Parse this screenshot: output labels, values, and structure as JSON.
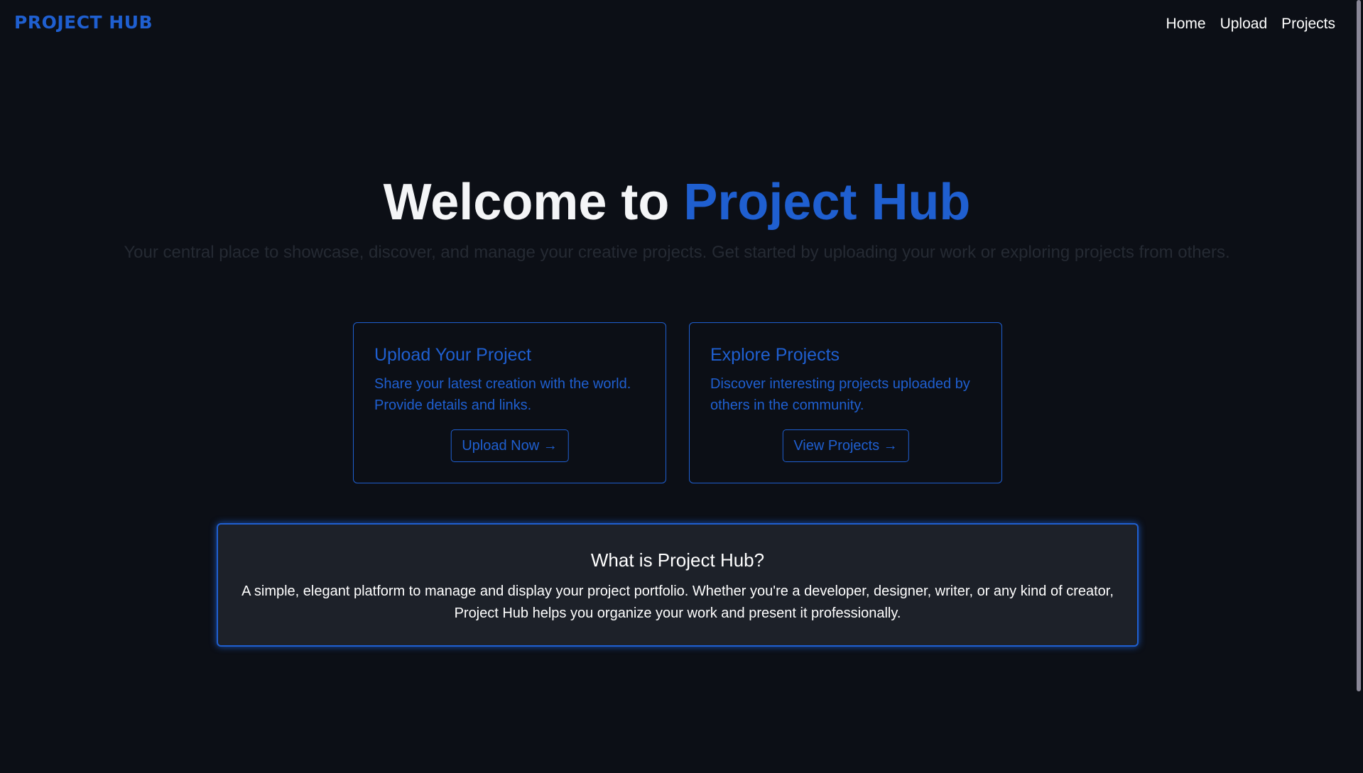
{
  "header": {
    "brand": "PROJECT HUB",
    "nav": [
      {
        "label": "Home"
      },
      {
        "label": "Upload"
      },
      {
        "label": "Projects"
      }
    ]
  },
  "hero": {
    "title_prefix": "Welcome to ",
    "title_accent": "Project Hub",
    "subtitle": "Your central place to showcase, discover, and manage your creative projects. Get started by uploading your work or exploring projects from others."
  },
  "cards": [
    {
      "title": "Upload Your Project",
      "description": "Share your latest creation with the world. Provide details and links.",
      "button": "Upload Now →"
    },
    {
      "title": "Explore Projects",
      "description": "Discover interesting projects uploaded by others in the community.",
      "button": "View Projects →"
    }
  ],
  "about": {
    "title": "What is Project Hub?",
    "text": "A simple, elegant platform to manage and display your project portfolio. Whether you're a developer, designer, writer, or any kind of creator, Project Hub helps you organize your work and present it professionally."
  },
  "colors": {
    "background": "#0c0f16",
    "accent": "#1f5fd0",
    "panel": "#1d2129",
    "text": "#ffffff"
  }
}
